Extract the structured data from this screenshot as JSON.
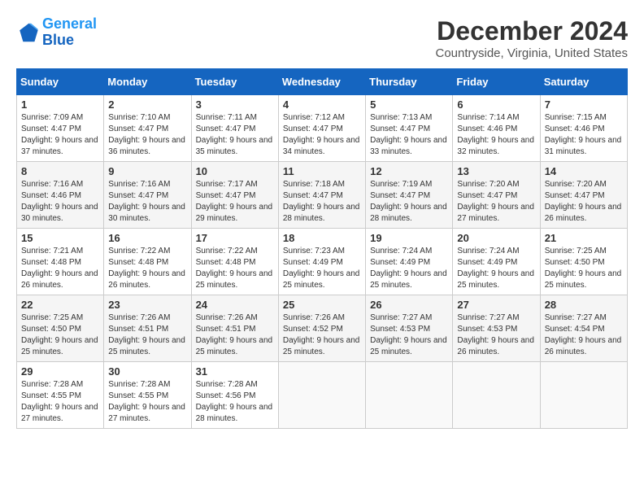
{
  "header": {
    "logo_line1": "General",
    "logo_line2": "Blue",
    "month_title": "December 2024",
    "subtitle": "Countryside, Virginia, United States"
  },
  "columns": [
    "Sunday",
    "Monday",
    "Tuesday",
    "Wednesday",
    "Thursday",
    "Friday",
    "Saturday"
  ],
  "weeks": [
    [
      {
        "day": "1",
        "sunrise": "7:09 AM",
        "sunset": "4:47 PM",
        "daylight": "9 hours and 37 minutes."
      },
      {
        "day": "2",
        "sunrise": "7:10 AM",
        "sunset": "4:47 PM",
        "daylight": "9 hours and 36 minutes."
      },
      {
        "day": "3",
        "sunrise": "7:11 AM",
        "sunset": "4:47 PM",
        "daylight": "9 hours and 35 minutes."
      },
      {
        "day": "4",
        "sunrise": "7:12 AM",
        "sunset": "4:47 PM",
        "daylight": "9 hours and 34 minutes."
      },
      {
        "day": "5",
        "sunrise": "7:13 AM",
        "sunset": "4:47 PM",
        "daylight": "9 hours and 33 minutes."
      },
      {
        "day": "6",
        "sunrise": "7:14 AM",
        "sunset": "4:46 PM",
        "daylight": "9 hours and 32 minutes."
      },
      {
        "day": "7",
        "sunrise": "7:15 AM",
        "sunset": "4:46 PM",
        "daylight": "9 hours and 31 minutes."
      }
    ],
    [
      {
        "day": "8",
        "sunrise": "7:16 AM",
        "sunset": "4:46 PM",
        "daylight": "9 hours and 30 minutes."
      },
      {
        "day": "9",
        "sunrise": "7:16 AM",
        "sunset": "4:47 PM",
        "daylight": "9 hours and 30 minutes."
      },
      {
        "day": "10",
        "sunrise": "7:17 AM",
        "sunset": "4:47 PM",
        "daylight": "9 hours and 29 minutes."
      },
      {
        "day": "11",
        "sunrise": "7:18 AM",
        "sunset": "4:47 PM",
        "daylight": "9 hours and 28 minutes."
      },
      {
        "day": "12",
        "sunrise": "7:19 AM",
        "sunset": "4:47 PM",
        "daylight": "9 hours and 28 minutes."
      },
      {
        "day": "13",
        "sunrise": "7:20 AM",
        "sunset": "4:47 PM",
        "daylight": "9 hours and 27 minutes."
      },
      {
        "day": "14",
        "sunrise": "7:20 AM",
        "sunset": "4:47 PM",
        "daylight": "9 hours and 26 minutes."
      }
    ],
    [
      {
        "day": "15",
        "sunrise": "7:21 AM",
        "sunset": "4:48 PM",
        "daylight": "9 hours and 26 minutes."
      },
      {
        "day": "16",
        "sunrise": "7:22 AM",
        "sunset": "4:48 PM",
        "daylight": "9 hours and 26 minutes."
      },
      {
        "day": "17",
        "sunrise": "7:22 AM",
        "sunset": "4:48 PM",
        "daylight": "9 hours and 25 minutes."
      },
      {
        "day": "18",
        "sunrise": "7:23 AM",
        "sunset": "4:49 PM",
        "daylight": "9 hours and 25 minutes."
      },
      {
        "day": "19",
        "sunrise": "7:24 AM",
        "sunset": "4:49 PM",
        "daylight": "9 hours and 25 minutes."
      },
      {
        "day": "20",
        "sunrise": "7:24 AM",
        "sunset": "4:49 PM",
        "daylight": "9 hours and 25 minutes."
      },
      {
        "day": "21",
        "sunrise": "7:25 AM",
        "sunset": "4:50 PM",
        "daylight": "9 hours and 25 minutes."
      }
    ],
    [
      {
        "day": "22",
        "sunrise": "7:25 AM",
        "sunset": "4:50 PM",
        "daylight": "9 hours and 25 minutes."
      },
      {
        "day": "23",
        "sunrise": "7:26 AM",
        "sunset": "4:51 PM",
        "daylight": "9 hours and 25 minutes."
      },
      {
        "day": "24",
        "sunrise": "7:26 AM",
        "sunset": "4:51 PM",
        "daylight": "9 hours and 25 minutes."
      },
      {
        "day": "25",
        "sunrise": "7:26 AM",
        "sunset": "4:52 PM",
        "daylight": "9 hours and 25 minutes."
      },
      {
        "day": "26",
        "sunrise": "7:27 AM",
        "sunset": "4:53 PM",
        "daylight": "9 hours and 25 minutes."
      },
      {
        "day": "27",
        "sunrise": "7:27 AM",
        "sunset": "4:53 PM",
        "daylight": "9 hours and 26 minutes."
      },
      {
        "day": "28",
        "sunrise": "7:27 AM",
        "sunset": "4:54 PM",
        "daylight": "9 hours and 26 minutes."
      }
    ],
    [
      {
        "day": "29",
        "sunrise": "7:28 AM",
        "sunset": "4:55 PM",
        "daylight": "9 hours and 27 minutes."
      },
      {
        "day": "30",
        "sunrise": "7:28 AM",
        "sunset": "4:55 PM",
        "daylight": "9 hours and 27 minutes."
      },
      {
        "day": "31",
        "sunrise": "7:28 AM",
        "sunset": "4:56 PM",
        "daylight": "9 hours and 28 minutes."
      },
      null,
      null,
      null,
      null
    ]
  ]
}
